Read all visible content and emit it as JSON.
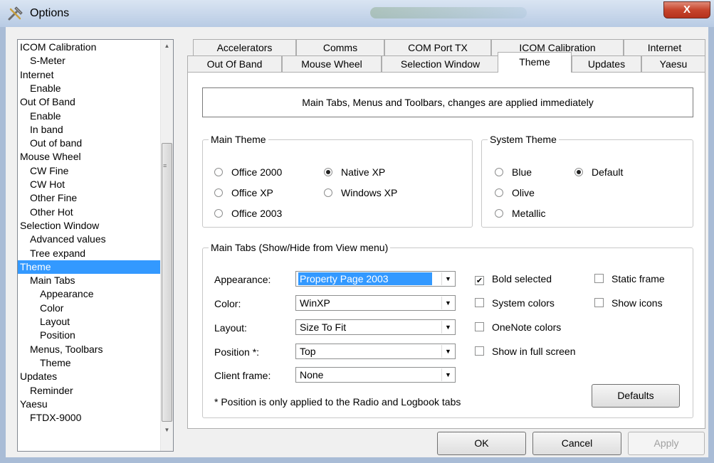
{
  "window": {
    "title": "Options",
    "close_glyph": "X",
    "icon": "tools-icon"
  },
  "tree": {
    "items": [
      {
        "label": "ICOM Calibration",
        "level": 0
      },
      {
        "label": "S-Meter",
        "level": 1
      },
      {
        "label": "Internet",
        "level": 0
      },
      {
        "label": "Enable",
        "level": 1
      },
      {
        "label": "Out Of Band",
        "level": 0
      },
      {
        "label": "Enable",
        "level": 1
      },
      {
        "label": "In band",
        "level": 1
      },
      {
        "label": "Out of band",
        "level": 1
      },
      {
        "label": "Mouse Wheel",
        "level": 0
      },
      {
        "label": "CW Fine",
        "level": 1
      },
      {
        "label": "CW Hot",
        "level": 1
      },
      {
        "label": "Other Fine",
        "level": 1
      },
      {
        "label": "Other Hot",
        "level": 1
      },
      {
        "label": "Selection Window",
        "level": 0
      },
      {
        "label": "Advanced values",
        "level": 1
      },
      {
        "label": "Tree expand",
        "level": 1
      },
      {
        "label": "Theme",
        "level": 0,
        "selected": true
      },
      {
        "label": "Main Tabs",
        "level": 1
      },
      {
        "label": "Appearance",
        "level": 2
      },
      {
        "label": "Color",
        "level": 2
      },
      {
        "label": "Layout",
        "level": 2
      },
      {
        "label": "Position",
        "level": 2
      },
      {
        "label": "Menus, Toolbars",
        "level": 1
      },
      {
        "label": "Theme",
        "level": 2
      },
      {
        "label": "Updates",
        "level": 0
      },
      {
        "label": "Reminder",
        "level": 1
      },
      {
        "label": "Yaesu",
        "level": 0
      },
      {
        "label": "FTDX-9000",
        "level": 1
      }
    ]
  },
  "tabs": {
    "row1": [
      "Accelerators",
      "Comms",
      "COM Port TX",
      "ICOM Calibration",
      "Internet"
    ],
    "row2": [
      "Out Of Band",
      "Mouse Wheel",
      "Selection Window",
      "Theme",
      "Updates",
      "Yaesu"
    ],
    "active": "Theme"
  },
  "theme_page": {
    "info_text": "Main Tabs, Menus and Toolbars, changes are applied immediately",
    "main_theme": {
      "label": "Main Theme",
      "options": [
        "Office 2000",
        "Office XP",
        "Office 2003",
        "Native XP",
        "Windows XP"
      ],
      "selected": "Native XP"
    },
    "system_theme": {
      "label": "System Theme",
      "options": [
        "Blue",
        "Olive",
        "Metallic",
        "Default"
      ],
      "selected": "Default"
    },
    "main_tabs": {
      "label": "Main Tabs (Show/Hide from View menu)",
      "fields": [
        {
          "label": "Appearance:",
          "value": "Property Page 2003",
          "highlighted": true
        },
        {
          "label": "Color:",
          "value": "WinXP"
        },
        {
          "label": "Layout:",
          "value": "Size To Fit"
        },
        {
          "label": "Position *:",
          "value": "Top"
        },
        {
          "label": "Client frame:",
          "value": "None"
        }
      ],
      "checkboxes": [
        {
          "label": "Bold selected",
          "checked": true
        },
        {
          "label": "System colors",
          "checked": false
        },
        {
          "label": "OneNote colors",
          "checked": false
        },
        {
          "label": "Show in full screen",
          "checked": false
        },
        {
          "label": "Static frame",
          "checked": false
        },
        {
          "label": "Show icons",
          "checked": false
        }
      ],
      "footnote": "* Position is only applied to the Radio and Logbook tabs",
      "defaults_label": "Defaults"
    }
  },
  "buttons": {
    "ok": "OK",
    "cancel": "Cancel",
    "apply": "Apply"
  },
  "colors": {
    "selection": "#3399ff",
    "titlebar": "#b8cbe4",
    "close": "#c6442c"
  }
}
